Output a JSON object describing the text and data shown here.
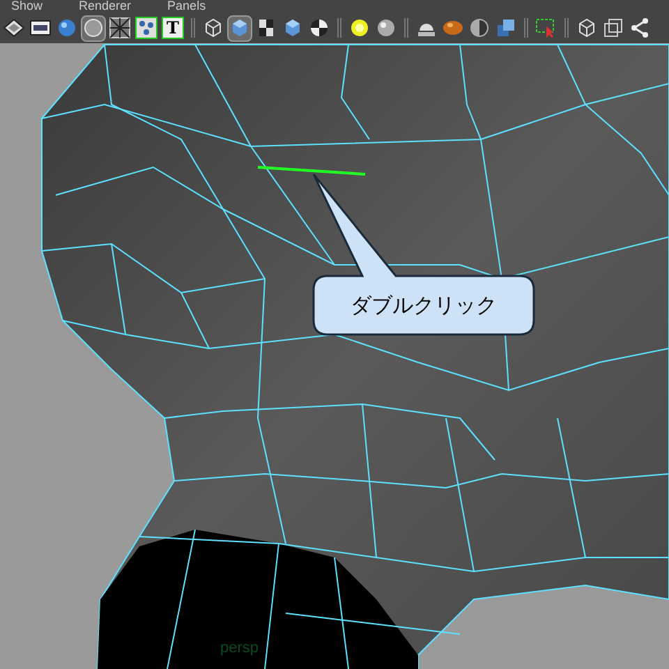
{
  "menu": [
    "Show",
    "Renderer",
    "Panels"
  ],
  "toolbar": [
    [
      {
        "kind": "layers",
        "selected": false
      },
      {
        "kind": "film",
        "selected": false
      },
      {
        "kind": "sphere",
        "selected": false
      },
      {
        "kind": "circle",
        "selected": true
      },
      {
        "kind": "grid",
        "selected": false
      },
      {
        "kind": "dots",
        "selected": false
      },
      {
        "kind": "text",
        "label": "T",
        "selected": false
      }
    ],
    [
      {
        "kind": "wire-cube",
        "selected": false
      },
      {
        "kind": "cube",
        "selected": true
      },
      {
        "kind": "checker-cube",
        "selected": false
      },
      {
        "kind": "cube",
        "selected": false
      },
      {
        "kind": "checker-ball",
        "selected": false
      }
    ],
    [
      {
        "kind": "light",
        "selected": false
      },
      {
        "kind": "gray-ball",
        "selected": false
      }
    ],
    [
      {
        "kind": "dome",
        "selected": false
      },
      {
        "kind": "orange-ball",
        "selected": false
      },
      {
        "kind": "half-ball",
        "selected": false
      },
      {
        "kind": "cubes",
        "selected": false
      }
    ],
    [
      {
        "kind": "marquee",
        "selected": false
      }
    ],
    [
      {
        "kind": "wire-cube",
        "selected": false
      },
      {
        "kind": "squares",
        "selected": false
      },
      {
        "kind": "share",
        "selected": false
      }
    ]
  ],
  "viewport": {
    "callout": "ダブルクリック",
    "camera": "persp"
  }
}
